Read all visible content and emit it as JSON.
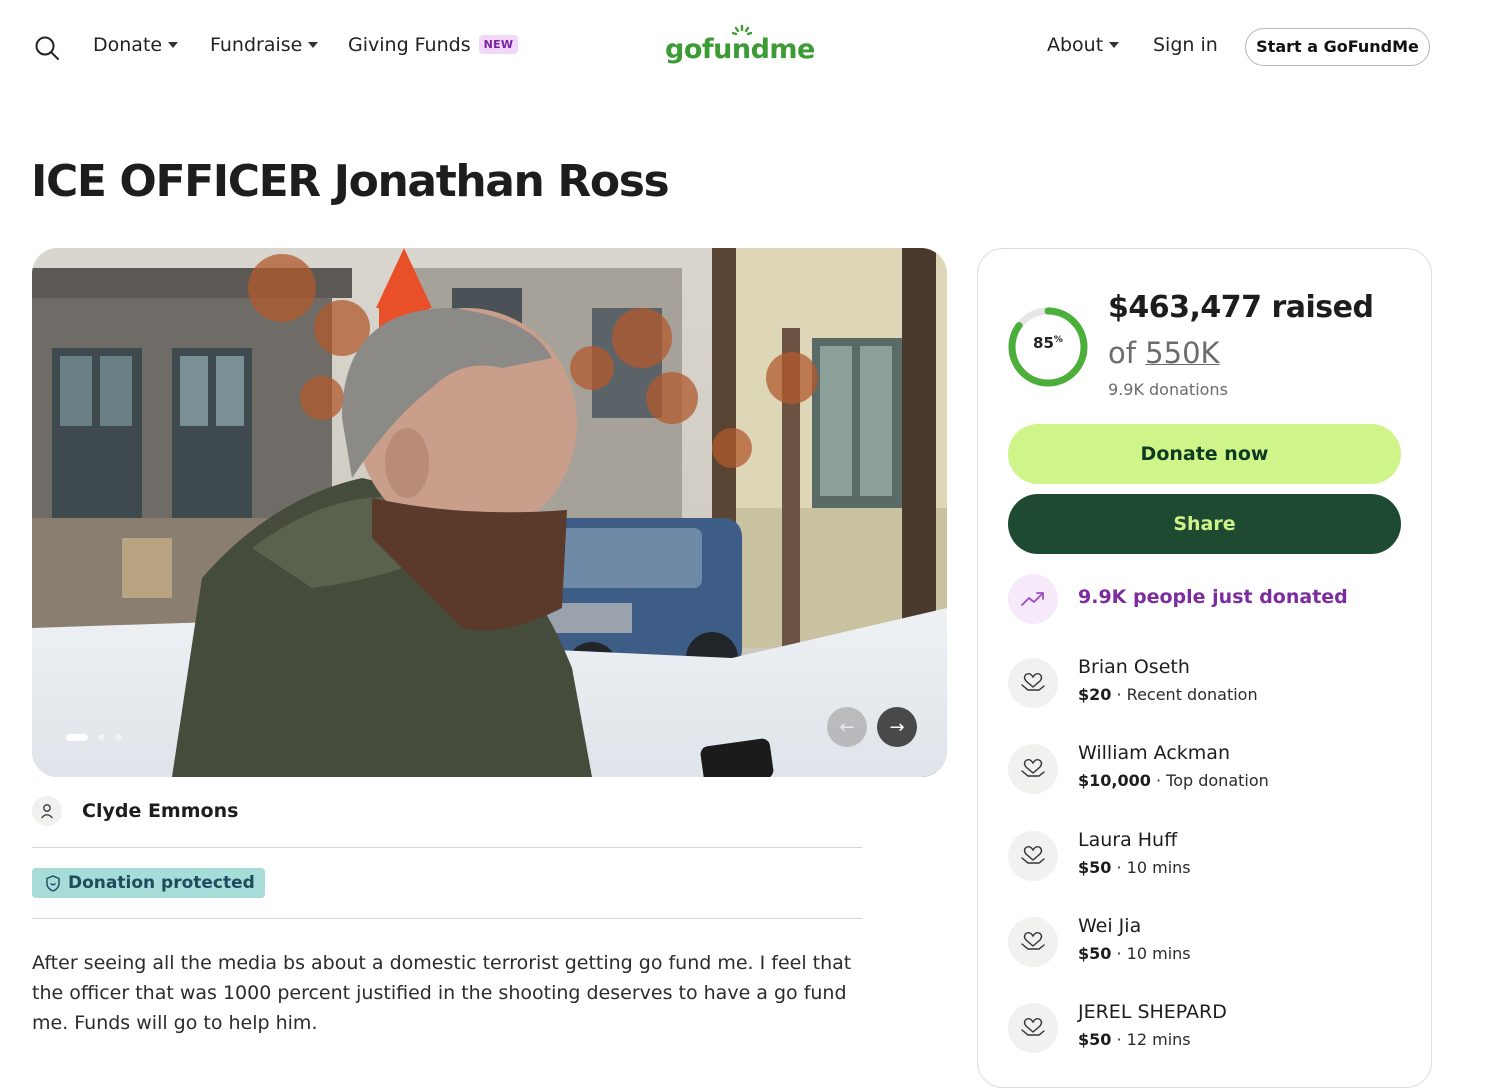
{
  "nav": {
    "donate_label": "Donate",
    "fundraise_label": "Fundraise",
    "giving_funds_label": "Giving Funds",
    "new_badge": "NEW",
    "logo_text": "gofundme",
    "about_label": "About",
    "signin_label": "Sign in",
    "start_label": "Start a GoFundMe"
  },
  "campaign": {
    "title": "ICE OFFICER Jonathan Ross",
    "organizer": "Clyde Emmons",
    "protected_label": "Donation protected",
    "story": "After seeing all the media bs about a domestic terrorist getting go fund me. I feel that the officer that was 1000 percent justified in the shooting deserves to have a go fund me. Funds will go to help him."
  },
  "carousel": {
    "slide_count": 3,
    "active_slide": 1,
    "prev_icon": "←",
    "next_icon": "→"
  },
  "progress": {
    "percent_value": 85,
    "percent_label": "85",
    "percent_sign": "%",
    "raised": "$463,477 raised",
    "goal_prefix": "of ",
    "goal_amount": "550K",
    "donations": "9.9K donations"
  },
  "actions": {
    "donate_label": "Donate now",
    "share_label": "Share"
  },
  "activity": {
    "trend_text": "9.9K people just donated"
  },
  "donors": [
    {
      "name": "Brian Oseth",
      "amount": "$20",
      "sep": " · ",
      "note": "Recent donation"
    },
    {
      "name": "William Ackman",
      "amount": "$10,000",
      "sep": " · ",
      "note": "Top donation"
    },
    {
      "name": "Laura Huff",
      "amount": "$50",
      "sep": " · ",
      "note": "10 mins"
    },
    {
      "name": "Wei Jia",
      "amount": "$50",
      "sep": " · ",
      "note": "10 mins"
    },
    {
      "name": "JEREL SHEPARD",
      "amount": "$50",
      "sep": " · ",
      "note": "12 mins"
    }
  ],
  "colors": {
    "brand_green": "#3d9b35",
    "donate_button": "#cef48a",
    "share_button": "#1e4a32",
    "ring_fill": "#4caf3b",
    "ring_track": "#e6e6e6",
    "protected_badge": "#a8dcd8",
    "trend_purple": "#7b2c9e"
  },
  "icons": {
    "search": "search-icon",
    "trend": "trend-up-icon",
    "donor": "heart-hand-icon",
    "organizer": "user-icon",
    "shield": "shield-icon"
  }
}
